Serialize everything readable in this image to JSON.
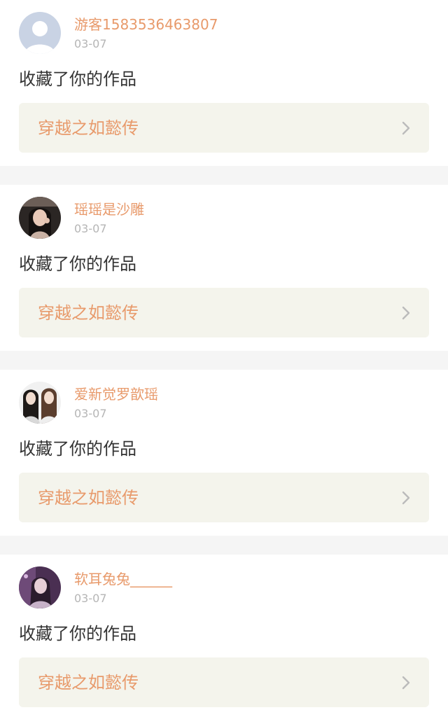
{
  "theme": {
    "accent": "#e89a6b",
    "card_bg": "#f4f4ec",
    "chevron": "#bbbbbb"
  },
  "notifications": [
    {
      "username": "游客1583536463807",
      "date": "03-07",
      "action": "收藏了你的作品",
      "work_title": "穿越之如懿传",
      "avatar": "default-avatar-icon"
    },
    {
      "username": "瑶瑶是沙雕",
      "date": "03-07",
      "action": "收藏了你的作品",
      "work_title": "穿越之如懿传",
      "avatar": "user-photo"
    },
    {
      "username": "爱新觉罗歆瑶",
      "date": "03-07",
      "action": "收藏了你的作品",
      "work_title": "穿越之如懿传",
      "avatar": "user-photo"
    },
    {
      "username": "软耳兔兔______",
      "date": "03-07",
      "action": "收藏了你的作品",
      "work_title": "穿越之如懿传",
      "avatar": "user-photo"
    }
  ]
}
